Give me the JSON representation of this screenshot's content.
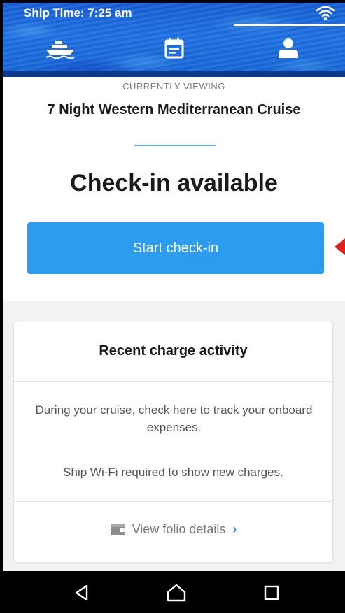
{
  "status_bar": {
    "ship_time": "Ship Time: 7:25 am",
    "wifi_icon": "wifi-icon"
  },
  "tabs": [
    {
      "icon": "ship-icon",
      "active": false
    },
    {
      "icon": "calendar-icon",
      "active": false
    },
    {
      "icon": "profile-icon",
      "active": true
    }
  ],
  "main": {
    "currently_viewing_label": "CURRENTLY VIEWING",
    "cruise_name": "7 Night Western Mediterranean Cruise",
    "checkin_title": "Check-in available",
    "checkin_button_label": "Start check-in"
  },
  "charges_card": {
    "title": "Recent charge activity",
    "body": "During your cruise, check here to track your onboard expenses.",
    "wifi_note": "Ship Wi-Fi required to show new charges.",
    "folio_link_label": "View folio details",
    "folio_icon": "wallet-icon"
  },
  "navbar": {
    "icons": [
      "back-icon",
      "home-icon",
      "recents-icon"
    ]
  },
  "colors": {
    "header_blue": "#1f73e6",
    "primary_button": "#2c9cf0",
    "accent_divider": "#5fb6e6",
    "pointer_red": "#e0241c",
    "link_blue": "#2c9cf0"
  }
}
